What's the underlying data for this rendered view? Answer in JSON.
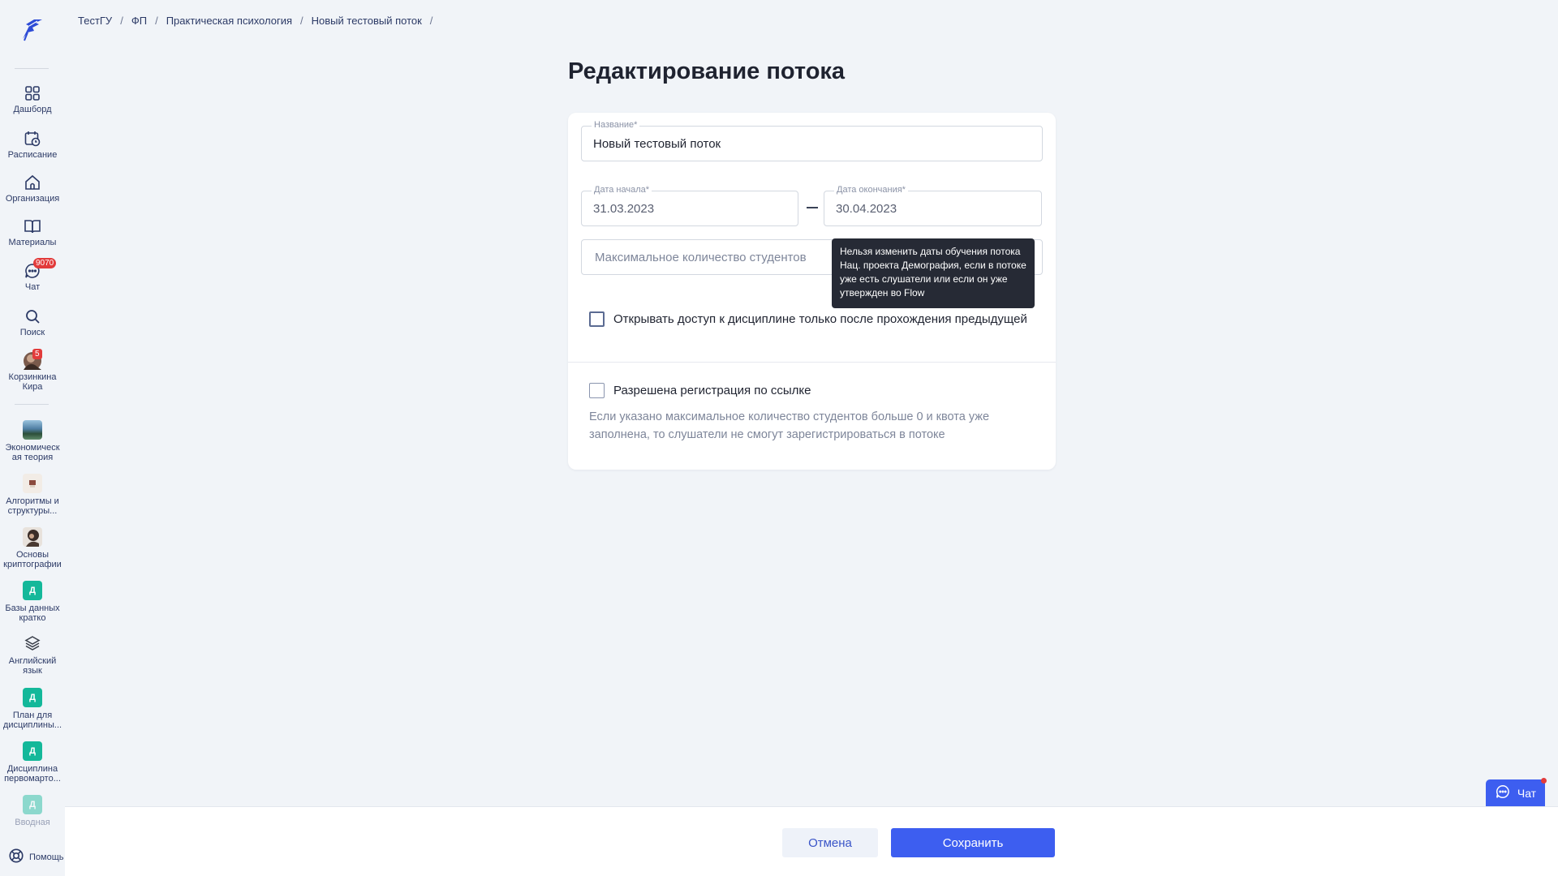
{
  "colors": {
    "accent": "#3d5ef0",
    "sidebar_text": "#2c3a66",
    "badge": "#e23b3b",
    "course_letter_thumb": "#14b89a",
    "tooltip_bg": "#262a35"
  },
  "breadcrumb": [
    {
      "label": "ТестГУ"
    },
    {
      "label": "ФП"
    },
    {
      "label": "Практическая психология"
    },
    {
      "label": "Новый тестовый поток"
    }
  ],
  "breadcrumb_separator": "/",
  "sidebar": {
    "nav": [
      {
        "label": "Дашборд",
        "icon": "grid-icon"
      },
      {
        "label": "Расписание",
        "icon": "calendar-clock-icon"
      },
      {
        "label": "Организация",
        "icon": "home-icon"
      },
      {
        "label": "Материалы",
        "icon": "book-icon"
      },
      {
        "label": "Чат",
        "icon": "chat-icon",
        "badge": "9070"
      },
      {
        "label": "Поиск",
        "icon": "search-icon"
      }
    ],
    "user": {
      "label": "Корзинкина Кира",
      "badge": "5"
    },
    "courses": [
      {
        "label": "Экономическ ая теория",
        "thumb": "image"
      },
      {
        "label": "Алгоритмы и структуры...",
        "thumb": "image"
      },
      {
        "label": "Основы криптографии",
        "thumb": "image"
      },
      {
        "label": "Базы данных кратко",
        "thumb": "Д"
      },
      {
        "label": "Английский язык",
        "thumb": "layers-icon"
      },
      {
        "label": "План для дисциплины...",
        "thumb": "Д"
      },
      {
        "label": "Дисциплина первомарто...",
        "thumb": "Д"
      },
      {
        "label": "Вводная",
        "thumb": "Д"
      }
    ],
    "help_label": "Помощь"
  },
  "page": {
    "title": "Редактирование потока"
  },
  "form": {
    "name": {
      "label": "Название*",
      "value": "Новый тестовый поток"
    },
    "start_date": {
      "label": "Дата начала*",
      "value": "31.03.2023"
    },
    "end_date": {
      "label": "Дата окончания*",
      "value": "30.04.2023"
    },
    "max_students": {
      "placeholder": "Максимальное количество студентов"
    },
    "sequential_access": {
      "label": "Открывать доступ к дисциплине только после прохождения предыдущей",
      "checked": false
    },
    "link_registration": {
      "label": "Разрешена регистрация по ссылке",
      "checked": false
    },
    "hint": "Если указано максимальное количество студентов больше 0 и квота уже заполнена, то слушатели не смогут зарегистрироваться в потоке"
  },
  "tooltip": "Нельзя изменить даты обучения потока Нац. проекта Демография, если в потоке уже есть слушатели или если он уже утвержден во Flow",
  "footer": {
    "cancel_label": "Отмена",
    "save_label": "Сохранить"
  },
  "chat_widget": {
    "label": "Чат"
  }
}
